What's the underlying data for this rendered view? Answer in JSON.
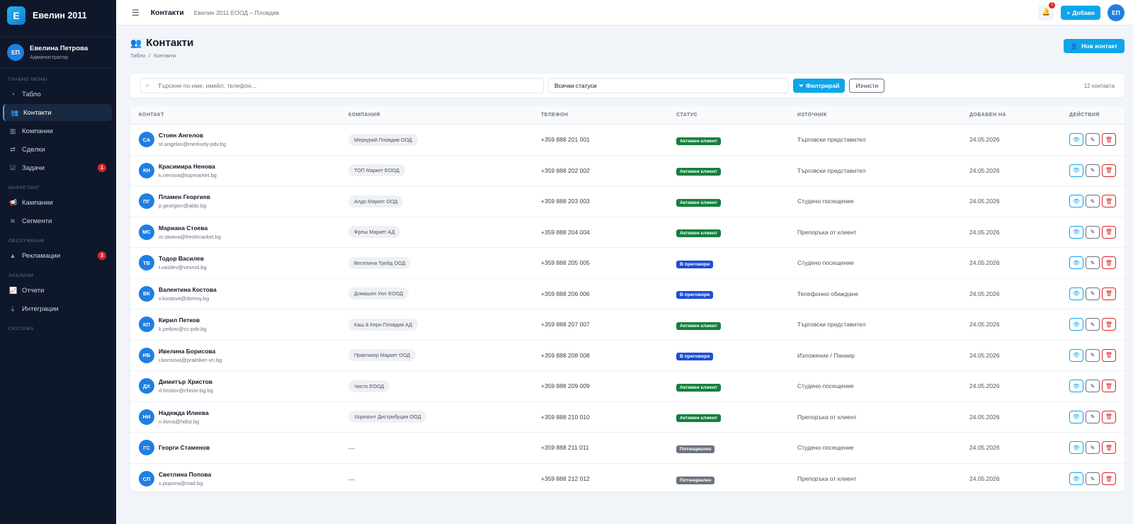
{
  "brand": {
    "logo_letter": "Е",
    "name": "Евелин 2011"
  },
  "user": {
    "initials": "ЕП",
    "name": "Евелина Петрова",
    "role": "Администратор"
  },
  "nav": {
    "section_main": "ГЛАВНО МЕНЮ",
    "section_marketing": "МАРКЕТИНГ",
    "section_service": "ОБСЛУЖВАНЕ",
    "section_analytics": "АНАЛИЗИ",
    "section_system": "СИСТЕМА",
    "dashboard": "Табло",
    "contacts": "Контакти",
    "companies": "Компании",
    "deals": "Сделки",
    "tasks": "Задачи",
    "tasks_badge": "1",
    "campaigns": "Кампании",
    "segments": "Сегменти",
    "complaints": "Рекламации",
    "complaints_badge": "3",
    "reports": "Отчети",
    "integrations": "Интеграции"
  },
  "topbar": {
    "title": "Контакти",
    "subtitle": "Евелин 2011 ЕООД – Пловдив",
    "notifications_badge": "1",
    "add_label": "Добави",
    "avatar_initials": "ЕП"
  },
  "page": {
    "title": "Контакти",
    "breadcrumb_home": "Табло",
    "breadcrumb_sep": "/",
    "breadcrumb_current": "Контакти",
    "new_contact_label": "Нов контакт"
  },
  "filter": {
    "search_placeholder": "Търсене по име, имейл, телефон...",
    "status_value": "Всички статуси",
    "filter_label": "Филтрирай",
    "clear_label": "Изчисти",
    "count_text": "12 контакта"
  },
  "table": {
    "headers": {
      "contact": "КОНТАКТ",
      "company": "КОМПАНИЯ",
      "phone": "ТЕЛЕФОН",
      "status": "СТАТУС",
      "source": "ИЗТОЧНИК",
      "added": "ДОБАВЕН НА",
      "actions": "ДЕЙСТВИЯ"
    },
    "rows": [
      {
        "initials": "СА",
        "name": "Стоян Ангелов",
        "email": "st.angelov@merkurly-pdv.bg",
        "company": "Меркурий Пловдив ООД",
        "phone": "+359 888 201 001",
        "status": "Активен клиент",
        "status_kind": "active",
        "source": "Търговски представител",
        "date": "24.05.2026"
      },
      {
        "initials": "КН",
        "name": "Красимира Ненова",
        "email": "k.nenova@topmarket.bg",
        "company": "ТОП Маркет ЕООД",
        "phone": "+359 888 202 002",
        "status": "Активен клиент",
        "status_kind": "active",
        "source": "Търговски представител",
        "date": "24.05.2026"
      },
      {
        "initials": "ПГ",
        "name": "Пламен Георгиев",
        "email": "p.georgiev@aldo.bg",
        "company": "Алдо Маркет ООД",
        "phone": "+359 888 203 003",
        "status": "Активен клиент",
        "status_kind": "active",
        "source": "Студено посещение",
        "date": "24.05.2026"
      },
      {
        "initials": "МС",
        "name": "Мариана Стоева",
        "email": "m.stoeva@freshmarket.bg",
        "company": "Фреш Маркет АД",
        "phone": "+359 888 204 004",
        "status": "Активен клиент",
        "status_kind": "active",
        "source": "Препоръка от клиент",
        "date": "24.05.2026"
      },
      {
        "initials": "ТВ",
        "name": "Тодор Василев",
        "email": "t.vasilev@vesrod.bg",
        "company": "Веселина Трейд ООД",
        "phone": "+359 888 205 005",
        "status": "В преговори",
        "status_kind": "nego",
        "source": "Студено посещение",
        "date": "24.05.2026"
      },
      {
        "initials": "ВК",
        "name": "Валентина Костова",
        "email": "v.kostova@domuy.bg",
        "company": "Домашен Уют ЕООД",
        "phone": "+359 888 206 006",
        "status": "В преговори",
        "status_kind": "nego",
        "source": "Телефонно обаждане",
        "date": "24.05.2026"
      },
      {
        "initials": "КП",
        "name": "Кирил Петков",
        "email": "k.petkov@cc-pdv.bg",
        "company": "Каш & Кери Пловдив АД",
        "phone": "+359 888 207 007",
        "status": "Активен клиент",
        "status_kind": "active",
        "source": "Търговски представител",
        "date": "24.05.2026"
      },
      {
        "initials": "ИБ",
        "name": "Ивелина Борисова",
        "email": "i.borisova@praktiker-vn.bg",
        "company": "Практикер Маркет ООД",
        "phone": "+359 888 208 008",
        "status": "В преговори",
        "status_kind": "nego",
        "source": "Изложение / Панаир",
        "date": "24.05.2026"
      },
      {
        "initials": "ДХ",
        "name": "Димитър Христов",
        "email": "d.hristov@chisto-bg.bg",
        "company": "Чисто ЕООД",
        "phone": "+359 888 209 009",
        "status": "Активен клиент",
        "status_kind": "active",
        "source": "Студено посещение",
        "date": "24.05.2026"
      },
      {
        "initials": "НИ",
        "name": "Надежда Илиева",
        "email": "n.ilieva@hdist.bg",
        "company": "Хоризонт Дистрибуция ООД",
        "phone": "+359 888 210 010",
        "status": "Активен клиент",
        "status_kind": "active",
        "source": "Препоръка от клиент",
        "date": "24.05.2026"
      },
      {
        "initials": "ГС",
        "name": "Георги Стаменов",
        "email": "",
        "company": "—",
        "phone": "+359 888 211 011",
        "status": "Потенциален",
        "status_kind": "pot",
        "source": "Студено посещение",
        "date": "24.05.2026"
      },
      {
        "initials": "СП",
        "name": "Светлина Попова",
        "email": "s.popova@mail.bg",
        "company": "—",
        "phone": "+359 888 212 012",
        "status": "Потенциален",
        "status_kind": "pot",
        "source": "Препоръка от клиент",
        "date": "24.05.2026"
      }
    ]
  },
  "colors": {
    "accent": "#0ea5e9",
    "sidebar": "#0f172a",
    "active": "#15803d",
    "negotiation": "#1d4ed8",
    "potential": "#6b7280",
    "danger": "#dc2626"
  },
  "icons": {
    "view": "eye-icon",
    "edit": "edit-icon",
    "delete": "trash-icon"
  }
}
